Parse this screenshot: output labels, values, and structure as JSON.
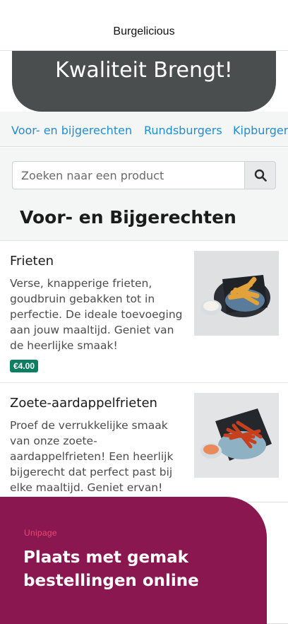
{
  "header": {
    "title": "Burgelicious"
  },
  "hero": {
    "text": "Kwaliteit Brengt!"
  },
  "categories": [
    {
      "label": "Voor- en bijgerechten"
    },
    {
      "label": "Rundsburgers"
    },
    {
      "label": "Kipburgers"
    }
  ],
  "search": {
    "placeholder": "Zoeken naar een product",
    "button_icon": "search-icon"
  },
  "section": {
    "title": "Voor- en Bijgerechten"
  },
  "products": [
    {
      "name": "Frieten",
      "description": "Verse, knapperige frieten, goudbruin gebakken tot in perfectie. De ideale toevoeging aan jouw maaltijd. Geniet van de heerlijke smaak!",
      "price": "€4.00"
    },
    {
      "name": "Zoete-aardappelfrieten",
      "description": "Proef de verrukkelijke smaak van onze zoete-aardappelfrieten! Een heerlijk bijgerecht dat perfect past bij elke maaltijd. Geniet ervan!"
    }
  ],
  "banner": {
    "logo": "Unipage",
    "headline": "Plaats met gemak bestellingen online"
  },
  "colors": {
    "accent_link": "#1e8ed4",
    "hero_bg": "#4a4e4e",
    "price_badge": "#0d7e62",
    "banner_bg": "#8a1750"
  }
}
